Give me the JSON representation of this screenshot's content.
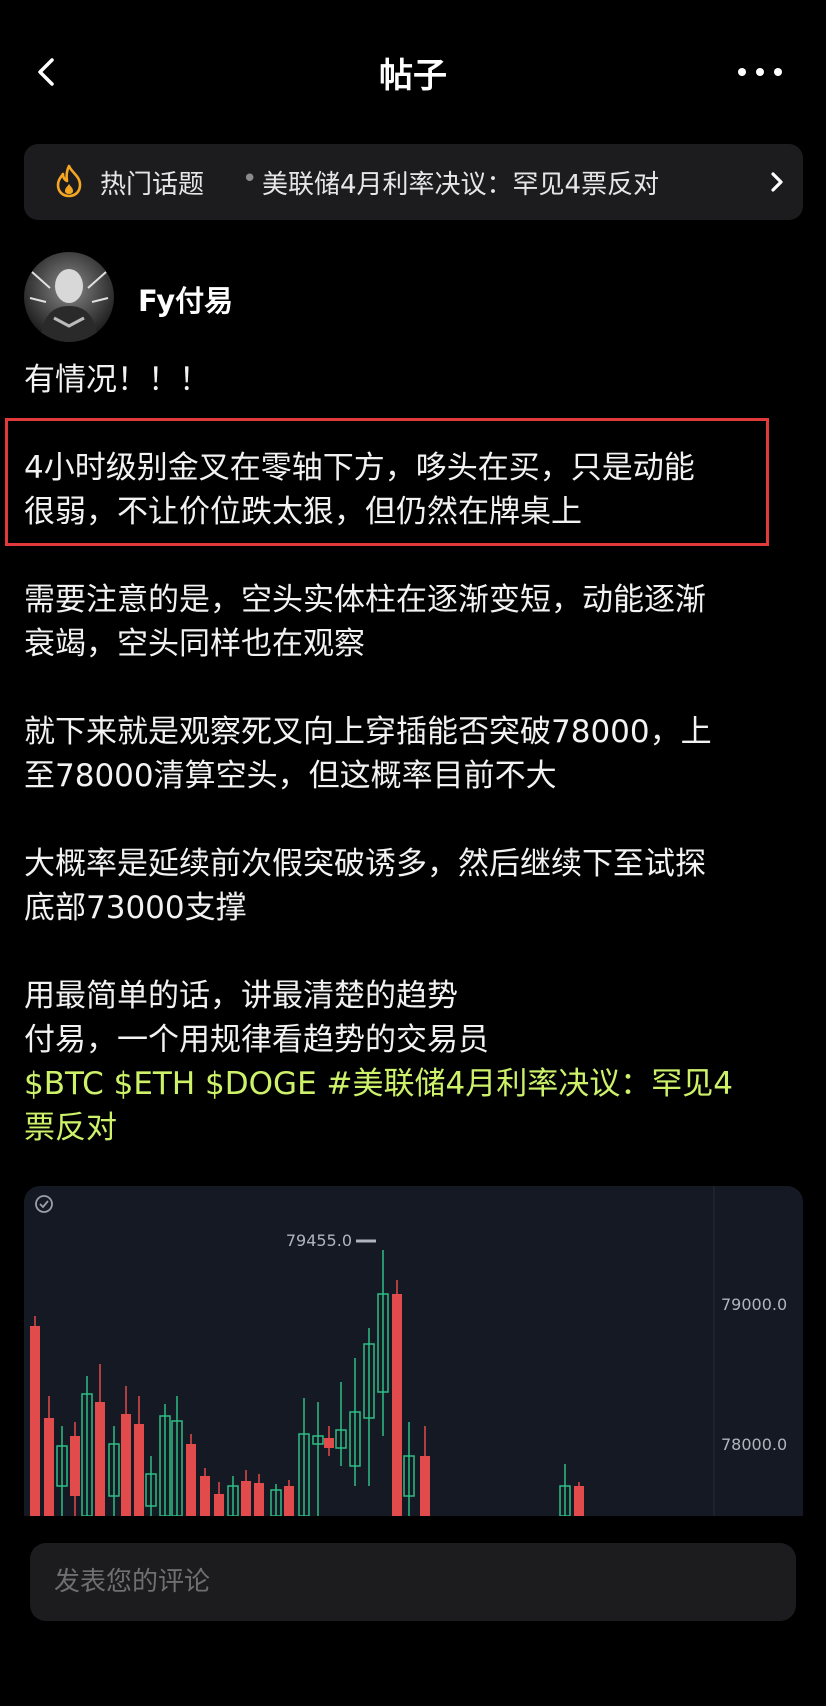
{
  "header": {
    "title": "帖子"
  },
  "topic": {
    "tag": "热门话题",
    "separator": "•",
    "title": "美联储4月利率决议：罕见4票反对"
  },
  "author": {
    "name": "Fy付易"
  },
  "post": {
    "exclaim": "有情况！！！",
    "p1_line1": "4小时级别金叉在零轴下方，哆头在买，只是动能",
    "p1_line2": "很弱，不让价位跌太狠，但仍然在牌桌上",
    "p2_line1": "需要注意的是，空头实体柱在逐渐变短，动能逐渐",
    "p2_line2": "衰竭，空头同样也在观察",
    "p3_line1": "就下来就是观察死叉向上穿插能否突破78000，上",
    "p3_line2": "至78000清算空头，但这概率目前不大",
    "p4_line1": "大概率是延续前次假突破诱多，然后继续下至试探",
    "p4_line2": "底部73000支撑",
    "p5_line1": "用最简单的话，讲最清楚的趋势",
    "p5_line2": "付易，一个用规律看趋势的交易员",
    "tags": [
      "$BTC",
      "$ETH",
      "$DOGE",
      "#美联储4月利率决议：罕见4"
    ],
    "tags_line2": "票反对"
  },
  "chart_data": {
    "type": "candlestick",
    "y_axis_labels": [
      "79000.0",
      "78000.0"
    ],
    "high_label": "79455.0",
    "colors": {
      "up": "#2ebd85",
      "down": "#e24b4b",
      "background": "#151923"
    }
  },
  "comment": {
    "placeholder": "发表您的评论"
  },
  "colors": {
    "tag_color": "#cdf26a",
    "highlight_box": "#e23a3a"
  }
}
